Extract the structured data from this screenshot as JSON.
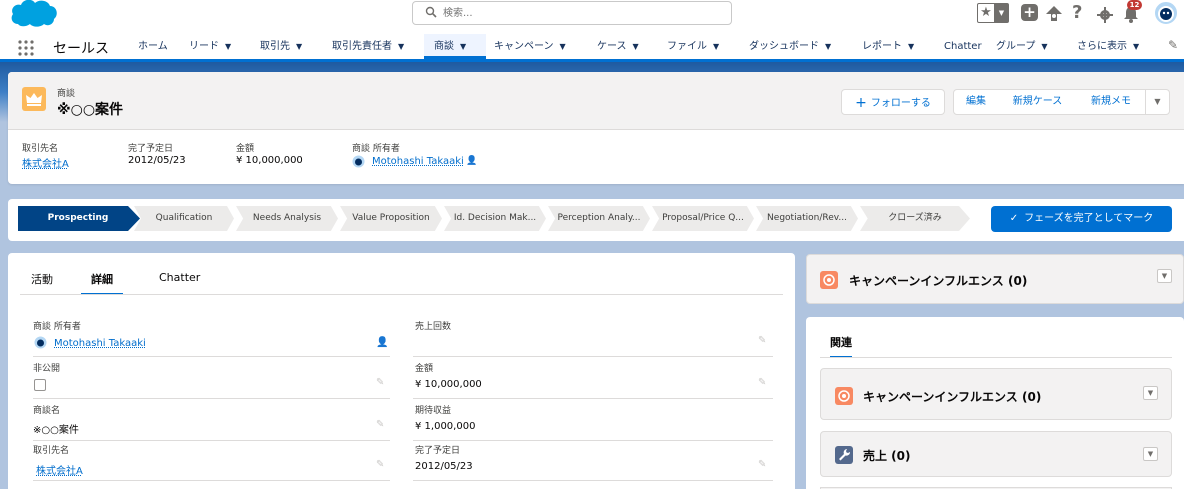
{
  "header": {
    "search_placeholder": "検索...",
    "notification_count": "12"
  },
  "nav": {
    "app_name": "セールス",
    "items": [
      {
        "label": "ホーム"
      },
      {
        "label": "リード"
      },
      {
        "label": "取引先"
      },
      {
        "label": "取引先責任者"
      },
      {
        "label": "商談"
      },
      {
        "label": "キャンペーン"
      },
      {
        "label": "ケース"
      },
      {
        "label": "ファイル"
      },
      {
        "label": "ダッシュボード"
      },
      {
        "label": "レポート"
      },
      {
        "label": "Chatter"
      },
      {
        "label": "グループ"
      },
      {
        "label": "さらに表示"
      }
    ]
  },
  "record": {
    "object_label": "商談",
    "name": "※○○案件",
    "follow_label": "フォローする",
    "actions": [
      "編集",
      "新規ケース",
      "新規メモ"
    ],
    "highlights": [
      {
        "label": "取引先名",
        "value": "株式会社A"
      },
      {
        "label": "完了予定日",
        "value": "2012/05/23"
      },
      {
        "label": "金額",
        "value": "¥ 10,000,000"
      },
      {
        "label": "商談 所有者",
        "value": "Motohashi Takaaki"
      }
    ]
  },
  "path": {
    "steps": [
      "Prospecting",
      "Qualification",
      "Needs Analysis",
      "Value Proposition",
      "Id. Decision Mak...",
      "Perception Analy...",
      "Proposal/Price Q...",
      "Negotiation/Rev...",
      "クローズ済み"
    ],
    "current_step": "Prospecting",
    "mark_complete_label": "フェーズを完了としてマーク"
  },
  "detail": {
    "tabs": [
      "活動",
      "詳細",
      "Chatter"
    ],
    "active_tab": "詳細",
    "left_fields": [
      {
        "label": "商談 所有者",
        "value": "Motohashi Takaaki"
      },
      {
        "label": "非公開",
        "value": ""
      },
      {
        "label": "商談名",
        "value": "※○○案件"
      },
      {
        "label": "取引先名",
        "value": "株式会社A"
      }
    ],
    "right_fields": [
      {
        "label": "売上回数",
        "value": ""
      },
      {
        "label": "金額",
        "value": "¥ 10,000,000"
      },
      {
        "label": "期待収益",
        "value": "¥ 1,000,000"
      },
      {
        "label": "完了予定日",
        "value": "2012/05/23"
      }
    ]
  },
  "sidebar": {
    "top_card_title": "キャンペーンインフルエンス (0)",
    "related_tab": "関連",
    "related_cards": [
      {
        "title": "キャンペーンインフルエンス (0)",
        "icon": "campaign-icon",
        "color": "#f88962"
      },
      {
        "title": "売上 (0)",
        "icon": "wrench-icon",
        "color": "#54698d"
      }
    ]
  },
  "colors": {
    "brand": "#0070d2",
    "opportunity_icon": "#fcb95b",
    "path_active": "#014486",
    "notification": "#c23934"
  }
}
